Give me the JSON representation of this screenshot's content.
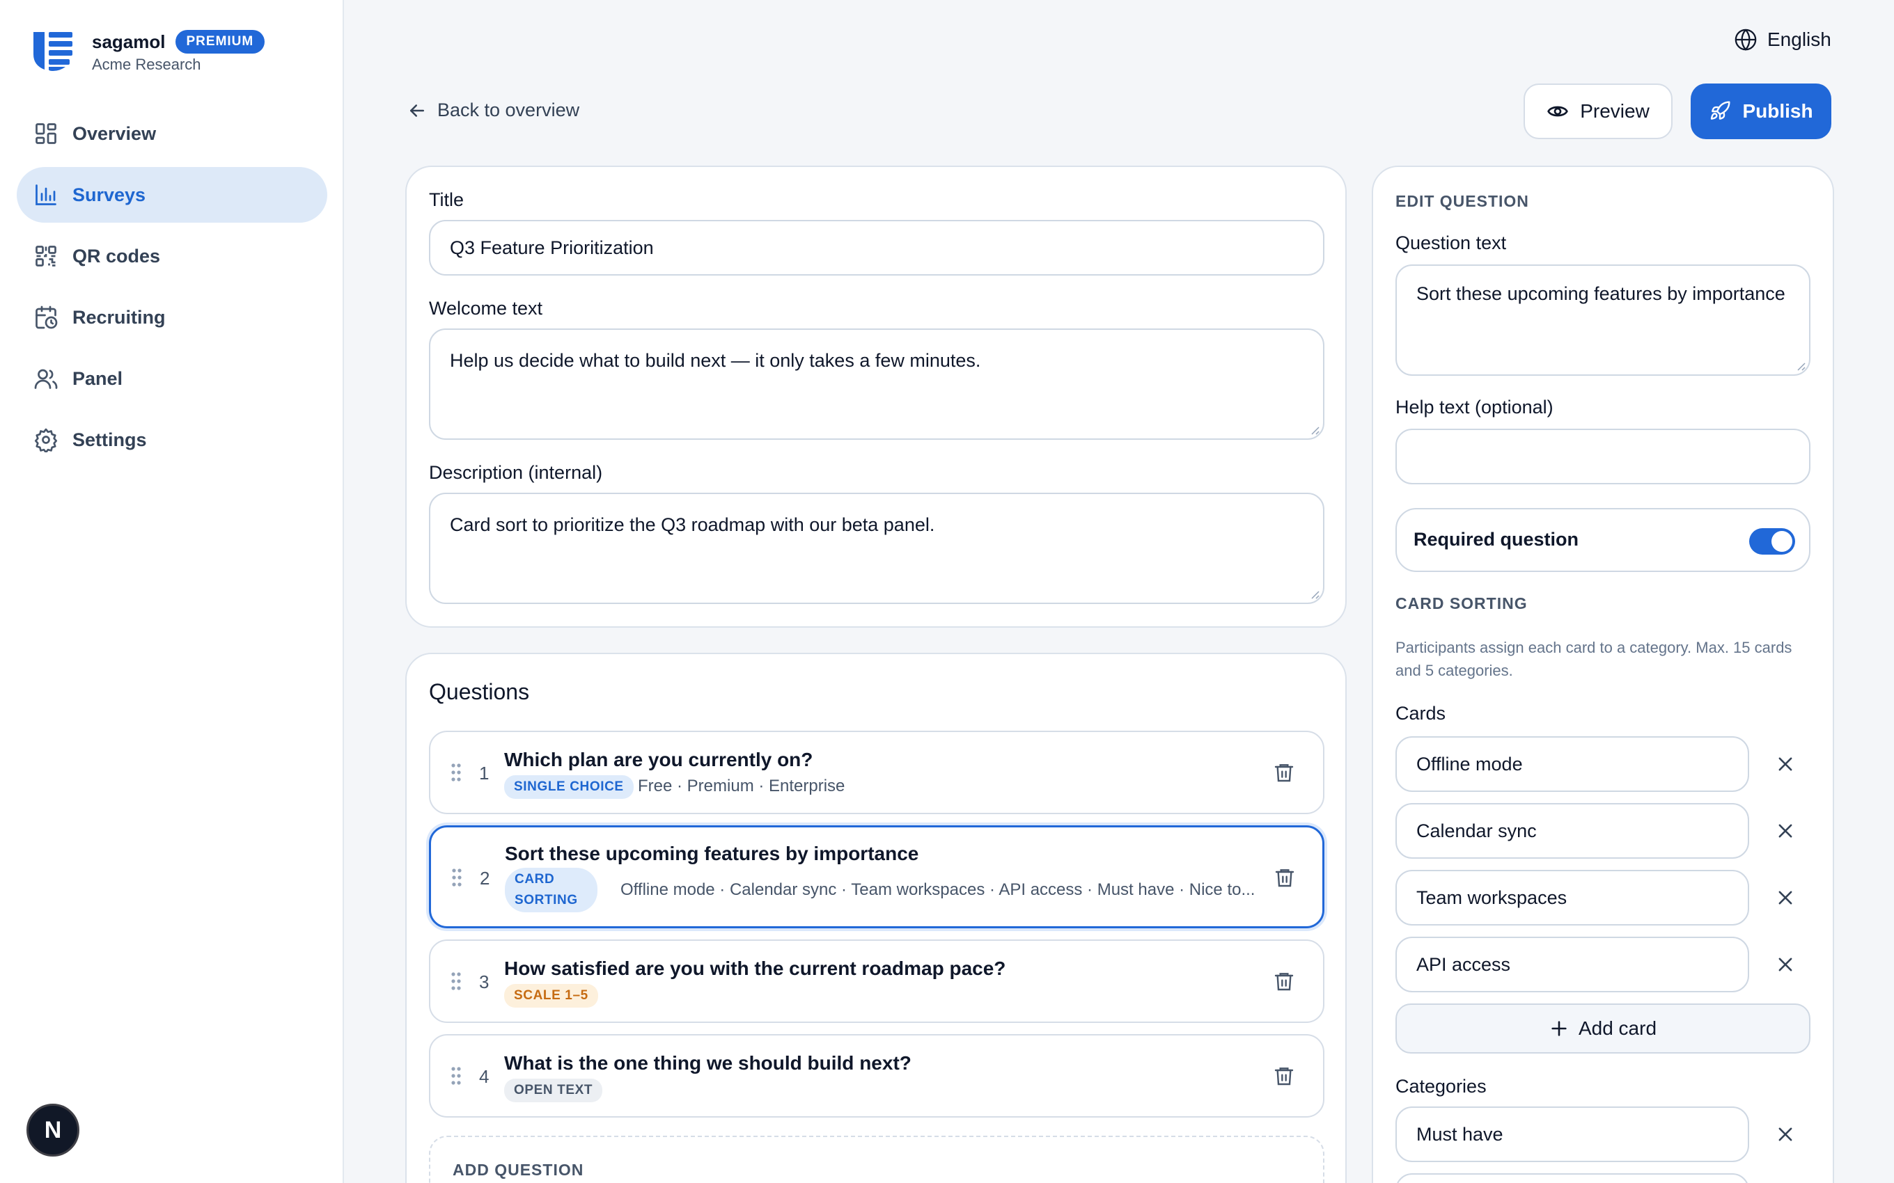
{
  "brand": {
    "name": "sagamol",
    "tier_badge": "PREMIUM",
    "org": "Acme Research"
  },
  "sidebar": {
    "items": [
      {
        "label": "Overview",
        "icon": "grid-icon",
        "active": false
      },
      {
        "label": "Surveys",
        "icon": "bar-chart-icon",
        "active": true
      },
      {
        "label": "QR codes",
        "icon": "qr-code-icon",
        "active": false
      },
      {
        "label": "Recruiting",
        "icon": "calendar-clock-icon",
        "active": false
      },
      {
        "label": "Panel",
        "icon": "users-icon",
        "active": false
      },
      {
        "label": "Settings",
        "icon": "gear-icon",
        "active": false
      }
    ]
  },
  "fab": {
    "letter": "N"
  },
  "header": {
    "language": "English",
    "back_label": "Back to overview",
    "preview_label": "Preview",
    "publish_label": "Publish"
  },
  "survey": {
    "title_label": "Title",
    "title_value": "Q3 Feature Prioritization",
    "welcome_label": "Welcome text",
    "welcome_value": "Help us decide what to build next — it only takes a few minutes.",
    "description_label": "Description (internal)",
    "description_value": "Card sort to prioritize the Q3 roadmap with our beta panel."
  },
  "questions": {
    "heading": "Questions",
    "items": [
      {
        "number": "1",
        "title": "Which plan are you currently on?",
        "type": "SINGLE CHOICE",
        "meta": "Free · Premium · Enterprise"
      },
      {
        "number": "2",
        "title": "Sort these upcoming features by importance",
        "type_line1": "CARD",
        "type_line2": "SORTING",
        "meta": "Offline mode · Calendar sync · Team workspaces · API access · Must have · Nice to..."
      },
      {
        "number": "3",
        "title": "How satisfied are you with the current roadmap pace?",
        "type": "SCALE 1–5",
        "meta": ""
      },
      {
        "number": "4",
        "title": "What is the one thing we should build next?",
        "type": "OPEN TEXT",
        "meta": ""
      }
    ],
    "add_question_label": "ADD QUESTION"
  },
  "edit": {
    "caption": "EDIT QUESTION",
    "question_text_label": "Question text",
    "question_text_value": "Sort these upcoming features by importance",
    "help_text_label": "Help text (optional)",
    "help_text_value": "",
    "required_label": "Required question",
    "required_on": true,
    "card_sorting_caption": "CARD SORTING",
    "card_sorting_help": "Participants assign each card to a category. Max. 15 cards and 5 categories.",
    "cards_label": "Cards",
    "cards": [
      "Offline mode",
      "Calendar sync",
      "Team workspaces",
      "API access"
    ],
    "add_card_label": "Add card",
    "categories_label": "Categories",
    "categories": [
      "Must have"
    ]
  },
  "colors": {
    "accent": "#2168d8",
    "accent_soft": "#dde9f8",
    "background": "#f4f6f9"
  }
}
